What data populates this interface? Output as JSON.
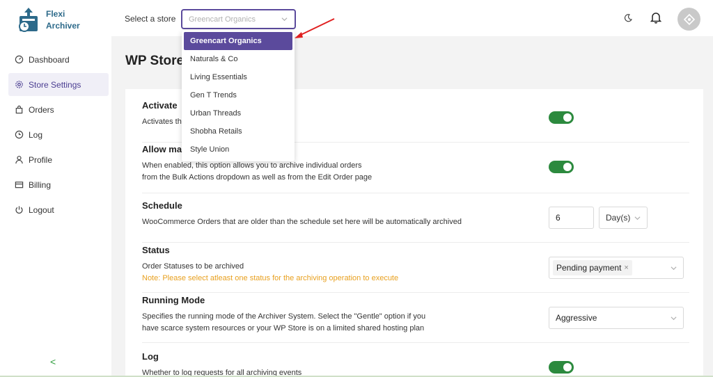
{
  "app": {
    "name_line1": "Flexi",
    "name_line2": "Archiver"
  },
  "sidebar": {
    "items": [
      {
        "label": "Dashboard",
        "icon": "dashboard-gauge-icon"
      },
      {
        "label": "Store Settings",
        "icon": "gear-icon",
        "active": true
      },
      {
        "label": "Orders",
        "icon": "shopping-bag-icon"
      },
      {
        "label": "Log",
        "icon": "clock-icon"
      },
      {
        "label": "Profile",
        "icon": "user-icon"
      },
      {
        "label": "Billing",
        "icon": "credit-card-icon"
      },
      {
        "label": "Logout",
        "icon": "power-icon"
      }
    ],
    "collapse_glyph": "<"
  },
  "topbar": {
    "store_label": "Select a store",
    "store_placeholder": "Greencart Organics"
  },
  "dropdown": {
    "options": [
      "Greencart Organics",
      "Naturals & Co",
      "Living Essentials",
      "Gen T Trends",
      "Urban Threads",
      "Shobha Retails",
      "Style Union"
    ],
    "selected": "Greencart Organics"
  },
  "page": {
    "title": "WP Store"
  },
  "settings": {
    "activate": {
      "title": "Activate",
      "desc": "Activates th",
      "enabled": true
    },
    "allow_manual": {
      "title": "Allow ma",
      "desc_line1": "When enabled, this option allows you to archive individual orders",
      "desc_line2": "from the Bulk Actions dropdown as well as from the Edit Order page",
      "enabled": true
    },
    "schedule": {
      "title": "Schedule",
      "desc": "WooCommerce Orders that are older than the schedule set here will be automatically archived",
      "value": "6",
      "unit": "Day(s)"
    },
    "status": {
      "title": "Status",
      "desc": "Order Statuses to be archived",
      "note": "Note: Please select atleast one status for the archiving operation to execute",
      "tag": "Pending payment",
      "tag_remove": "×"
    },
    "running_mode": {
      "title": "Running Mode",
      "desc_line1": "Specifies the running mode of the Archiver System. Select the \"Gentle\" option if you",
      "desc_line2": "have scarce system resources or your WP Store is on a limited shared hosting plan",
      "value": "Aggressive"
    },
    "log": {
      "title": "Log",
      "desc": "Whether to log requests for all archiving events",
      "enabled": true
    }
  },
  "colors": {
    "accent": "#5b4a9c",
    "toggle_on": "#2c8a3e",
    "warning": "#e8a01f",
    "arrow": "#e02020"
  }
}
